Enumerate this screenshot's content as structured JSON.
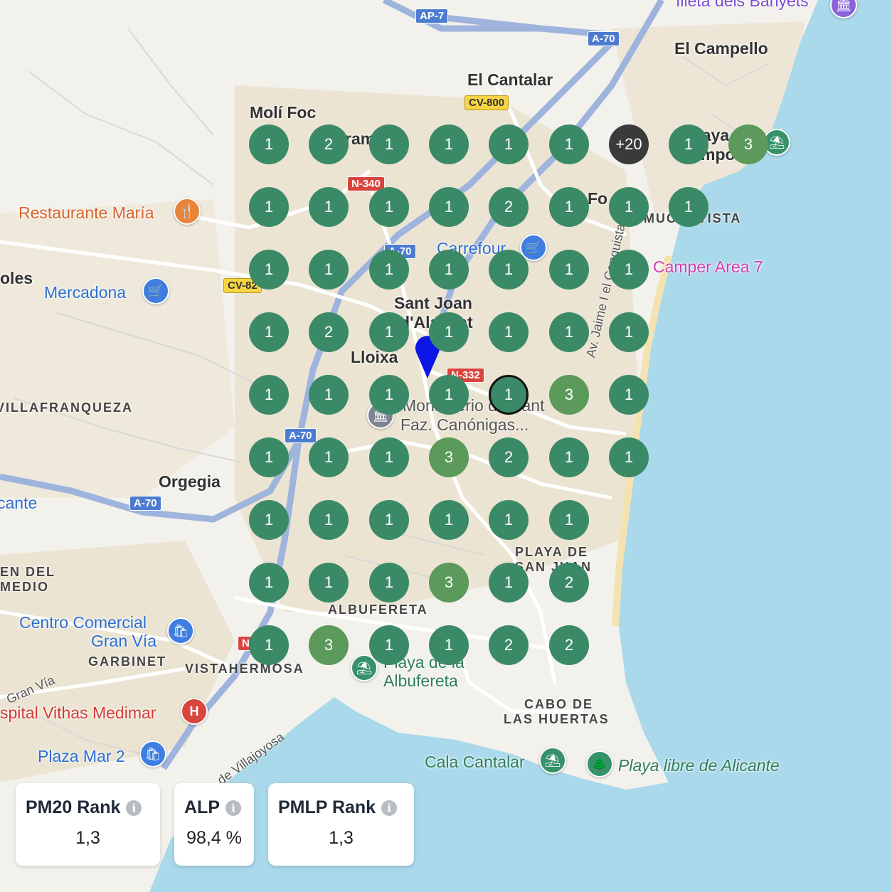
{
  "map": {
    "towns": [
      {
        "id": "el-campello",
        "text": "El Campello"
      },
      {
        "id": "el-cantalar",
        "text": "El Cantalar"
      },
      {
        "id": "moli-foc",
        "text": "Molí Foc"
      },
      {
        "id": "sant-joan",
        "text": "Sant Joan"
      },
      {
        "id": "sant-joan-2",
        "text": "d'Alacant"
      },
      {
        "id": "lloixa",
        "text": "Lloixa"
      },
      {
        "id": "orgegia",
        "text": "Orgegia"
      },
      {
        "id": "vilafranqueza",
        "text": "VILLAFRANQUEZA"
      },
      {
        "id": "olles",
        "text": "oles"
      },
      {
        "id": "cante",
        "text": "cante"
      },
      {
        "id": "playa-de",
        "text": "PLAYA DE"
      },
      {
        "id": "san-juan",
        "text": "SAN JUAN"
      },
      {
        "id": "albufereta",
        "text": "ALBUFERETA"
      },
      {
        "id": "garbinet",
        "text": "GARBINET"
      },
      {
        "id": "vistahermosa",
        "text": "VISTAHERMOSA"
      },
      {
        "id": "cabo",
        "text": "CABO DE"
      },
      {
        "id": "las-huertas",
        "text": "LAS HUERTAS"
      },
      {
        "id": "pen-del",
        "text": "EN DEL"
      },
      {
        "id": "medio",
        "text": "MEDIO"
      },
      {
        "id": "muchavista",
        "text": "MUCHAVISTA"
      },
      {
        "id": "fo",
        "text": "Fo"
      },
      {
        "id": "ram",
        "text": "ram"
      }
    ],
    "pois": [
      {
        "id": "restaurante-maria",
        "text": "Restaurante María",
        "icon": "fork-knife-icon"
      },
      {
        "id": "mercadona",
        "text": "Mercadona",
        "icon": "cart-icon"
      },
      {
        "id": "carrefour",
        "text": "Carrefour",
        "icon": "cart-icon"
      },
      {
        "id": "camper-area",
        "text": "Camper Area 7",
        "icon": "camper-icon"
      },
      {
        "id": "monasterio",
        "text": "Monasterio de Sant",
        "icon": "museum-icon"
      },
      {
        "id": "faz",
        "text": "Faz. Canónigas...",
        "icon": ""
      },
      {
        "id": "centro-comercial",
        "text": "Centro Comercial",
        "icon": "shopping-bag-icon"
      },
      {
        "id": "gran-via-cc",
        "text": "Gran Vía",
        "icon": ""
      },
      {
        "id": "hospital",
        "text": "spital Vithas Medimar",
        "icon": "hospital-icon"
      },
      {
        "id": "plaza-mar",
        "text": "Plaza Mar 2",
        "icon": "shopping-bag-icon"
      },
      {
        "id": "playa-albufereta-1",
        "text": "Playa de la",
        "icon": "beach-icon"
      },
      {
        "id": "playa-albufereta-2",
        "text": "Albufereta",
        "icon": ""
      },
      {
        "id": "cala-cantalar",
        "text": "Cala Cantalar",
        "icon": "beach-icon"
      },
      {
        "id": "playa-libre",
        "text": "Playa libre de Alicante",
        "icon": "tree-icon"
      },
      {
        "id": "illeta",
        "text": "Illeta dels Banyets",
        "icon": "landmark-icon"
      },
      {
        "id": "playa-c",
        "text": "Playa C",
        "icon": ""
      },
      {
        "id": "campo",
        "text": "mpo",
        "icon": ""
      },
      {
        "id": "beach-campello",
        "text": "",
        "icon": "beach-icon"
      }
    ],
    "streets": [
      {
        "id": "av-jaime",
        "text": "Av. Jaime I el Conquistador"
      },
      {
        "id": "av-villajoyosa",
        "text": "Av. de Villajoyosa"
      },
      {
        "id": "gran-via-street",
        "text": "Gran Vía"
      }
    ],
    "shields": [
      {
        "id": "ap7",
        "text": "AP-7",
        "kind": "blue"
      },
      {
        "id": "a70-top",
        "text": "A-70",
        "kind": "blue"
      },
      {
        "id": "a70-mid",
        "text": "A-70",
        "kind": "blue"
      },
      {
        "id": "a70-low",
        "text": "A-70",
        "kind": "blue"
      },
      {
        "id": "a70-left",
        "text": "A-70",
        "kind": "blue"
      },
      {
        "id": "cv800",
        "text": "CV-800",
        "kind": "yellow"
      },
      {
        "id": "cv82",
        "text": "CV-82",
        "kind": "yellow"
      },
      {
        "id": "n340",
        "text": "N-340",
        "kind": "red"
      },
      {
        "id": "n332",
        "text": "N-332",
        "kind": "red"
      },
      {
        "id": "n-low",
        "text": "N",
        "kind": "red"
      }
    ]
  },
  "grid": {
    "rows": [
      [
        "1",
        "2",
        "1",
        "1",
        "1",
        "1",
        "+20",
        "1",
        "3"
      ],
      [
        "1",
        "1",
        "1",
        "1",
        "2",
        "1",
        "1",
        "1"
      ],
      [
        "1",
        "1",
        "1",
        "1",
        "1",
        "1",
        "1"
      ],
      [
        "1",
        "2",
        "1",
        "1",
        "1",
        "1",
        "1"
      ],
      [
        "1",
        "1",
        "1",
        "1",
        "1",
        "3",
        "1"
      ],
      [
        "1",
        "1",
        "1",
        "3",
        "2",
        "1",
        "1"
      ],
      [
        "1",
        "1",
        "1",
        "1",
        "1",
        "1"
      ],
      [
        "1",
        "1",
        "1",
        "3",
        "1",
        "2"
      ],
      [
        "1",
        "3",
        "1",
        "1",
        "2",
        "2"
      ]
    ],
    "selected": {
      "row": 4,
      "col": 4
    },
    "colors": {
      "rank_1_2": "#3b8a67",
      "rank_3": "#5b9a5a",
      "rank_over_20": "#3a3a3a"
    }
  },
  "metrics": [
    {
      "label": "PM20 Rank",
      "value": "1,3"
    },
    {
      "label": "ALP",
      "value": "98,4 %"
    },
    {
      "label": "PMLP Rank",
      "value": "1,3"
    }
  ],
  "location_pin": {
    "icon": "location-pin-icon",
    "color": "#0a15e6"
  }
}
